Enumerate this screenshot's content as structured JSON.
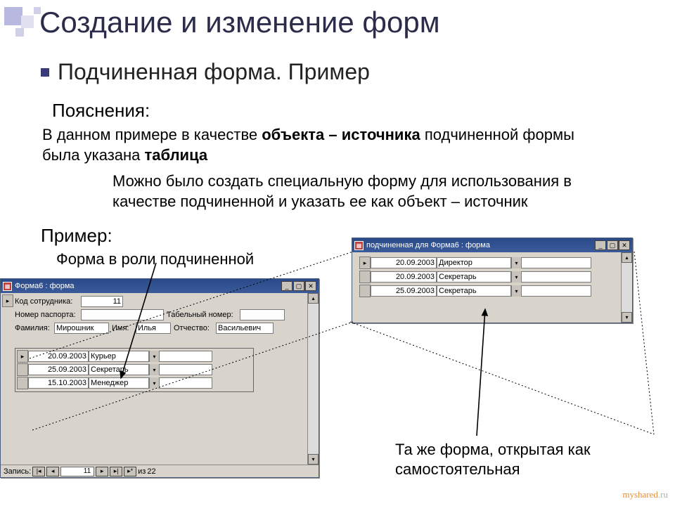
{
  "slide": {
    "title": "Создание и изменение форм",
    "subtitle": "Подчиненная форма. Пример",
    "notes_label": "Пояснения:",
    "p1_a": "В данном примере в качестве ",
    "p1_b": "объекта – источника",
    "p1_c": " подчиненной формы была указана ",
    "p1_d": "таблица",
    "p2": "Можно было создать специальную форму для использования в качестве подчиненной и указать ее как объект – источник",
    "example_label": "Пример:",
    "example_sub": "Форма в роли подчиненной",
    "same_form": "Та же форма, открытая как самостоятельная",
    "watermark_a": "myshared",
    "watermark_b": ".ru"
  },
  "main_window": {
    "title": "Форма6 : форма",
    "labels": {
      "code": "Код сотрудника:",
      "passport": "Номер паспорта:",
      "tabel": "Табельный номер:",
      "lastname": "Фамилия:",
      "firstname": "Имя:",
      "middlename": "Отчество:"
    },
    "values": {
      "code": "11",
      "passport": "",
      "tabel": "",
      "lastname": "Мирошник",
      "firstname": "Илья",
      "middlename": "Васильевич"
    },
    "subform_rows": [
      {
        "date": "20.09.2003",
        "role": "Курьер"
      },
      {
        "date": "25.09.2003",
        "role": "Секретарь"
      },
      {
        "date": "15.10.2003",
        "role": "Менеджер"
      }
    ],
    "nav": {
      "label": "Запись:",
      "current": "11",
      "of_label": "из",
      "total": "22"
    }
  },
  "sub_window": {
    "title": "подчиненная для Форма6 : форма",
    "rows": [
      {
        "date": "20.09.2003",
        "role": "Директор"
      },
      {
        "date": "20.09.2003",
        "role": "Секретарь"
      },
      {
        "date": "25.09.2003",
        "role": "Секретарь"
      }
    ]
  }
}
